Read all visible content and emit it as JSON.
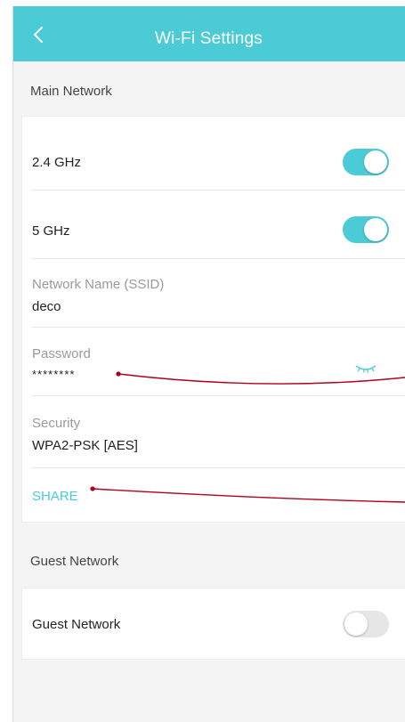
{
  "header": {
    "title": "Wi-Fi Settings"
  },
  "main_network": {
    "section_label": "Main Network",
    "band_24": {
      "label": "2.4 GHz",
      "enabled": true
    },
    "band_5": {
      "label": "5 GHz",
      "enabled": true
    },
    "ssid": {
      "label": "Network Name (SSID)",
      "value": "deco"
    },
    "password": {
      "label": "Password",
      "value": "********"
    },
    "security": {
      "label": "Security",
      "value": "WPA2-PSK [AES]"
    },
    "share_label": "SHARE"
  },
  "guest_network": {
    "section_label": "Guest Network",
    "toggle_label": "Guest Network",
    "enabled": false
  },
  "colors": {
    "accent": "#4acbd6",
    "toggle_off": "#e6e6e6",
    "callout_line": "#b0001e"
  },
  "icons": {
    "back": "chevron-left-icon",
    "password_visibility": "eye-closed-icon"
  }
}
